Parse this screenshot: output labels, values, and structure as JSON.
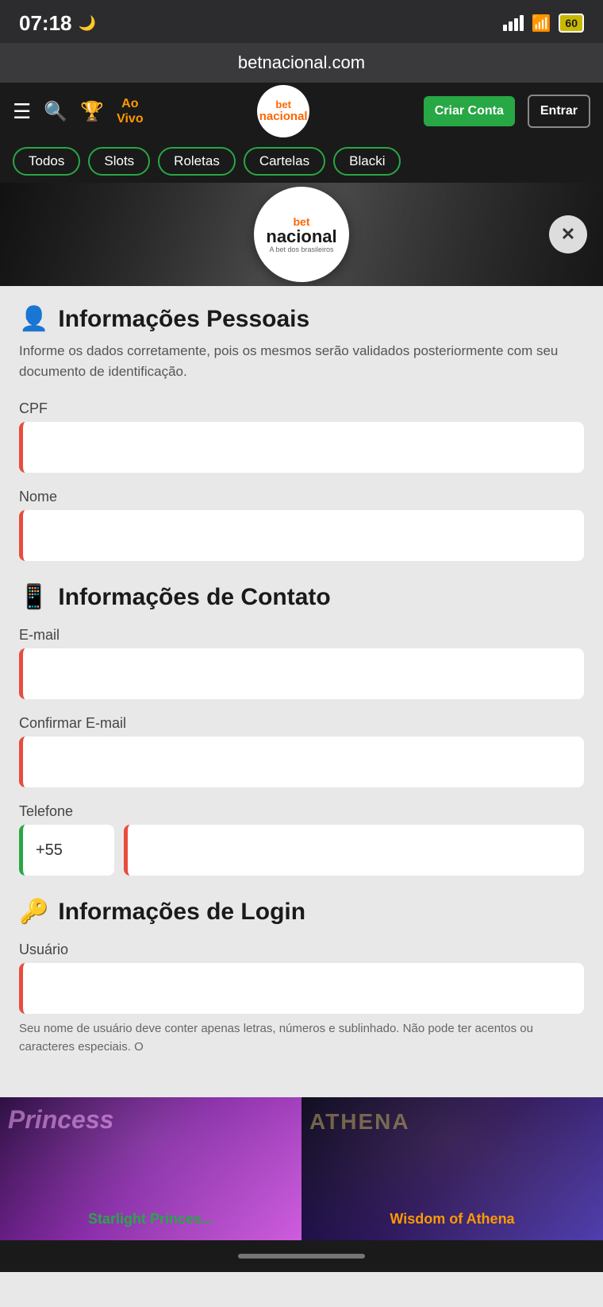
{
  "statusBar": {
    "time": "07:18",
    "moonIcon": "🌙",
    "batteryLevel": "60",
    "url": "betnacional.com"
  },
  "navBar": {
    "logoTextTop": "bet",
    "logoTextBottom": "nacional",
    "logoSub": "A bet dos brasileiros",
    "aoVivo": "Ao\nVivo",
    "criarConta": "Criar Conta",
    "entrar": "Entrar"
  },
  "categoryTabs": [
    "Todos",
    "Slots",
    "Roletas",
    "Cartelas",
    "Blacki"
  ],
  "heroLogo": {
    "top": "bet",
    "bottom": "nacional",
    "sub": "A bet dos brasileiros"
  },
  "form": {
    "personalSection": {
      "title": "Informações Pessoais",
      "desc": "Informe os dados corretamente, pois os mesmos serão validados posteriormente com seu documento de identificação."
    },
    "cpfLabel": "CPF",
    "cpfPlaceholder": "",
    "nomeLabel": "Nome",
    "nomePlaceholder": "",
    "contactSection": {
      "title": "Informações de Contato"
    },
    "emailLabel": "E-mail",
    "emailPlaceholder": "",
    "confirmEmailLabel": "Confirmar E-mail",
    "confirmEmailPlaceholder": "",
    "telefoneLabel": "Telefone",
    "countryCode": "+55",
    "loginSection": {
      "title": "Informações de Login"
    },
    "usuarioLabel": "Usuário",
    "usuarioPlaceholder": "",
    "usuarioHint": "Seu nome de usuário deve conter apenas letras, números e sublinhado. Não pode ter acentos ou caracteres especiais. O"
  },
  "bottomGames": [
    {
      "title": "Starlight Princes...",
      "overlayText": "Princess"
    },
    {
      "title": "Wisdom of Athena",
      "overlayText": "ATHENA"
    }
  ],
  "homeBar": {}
}
